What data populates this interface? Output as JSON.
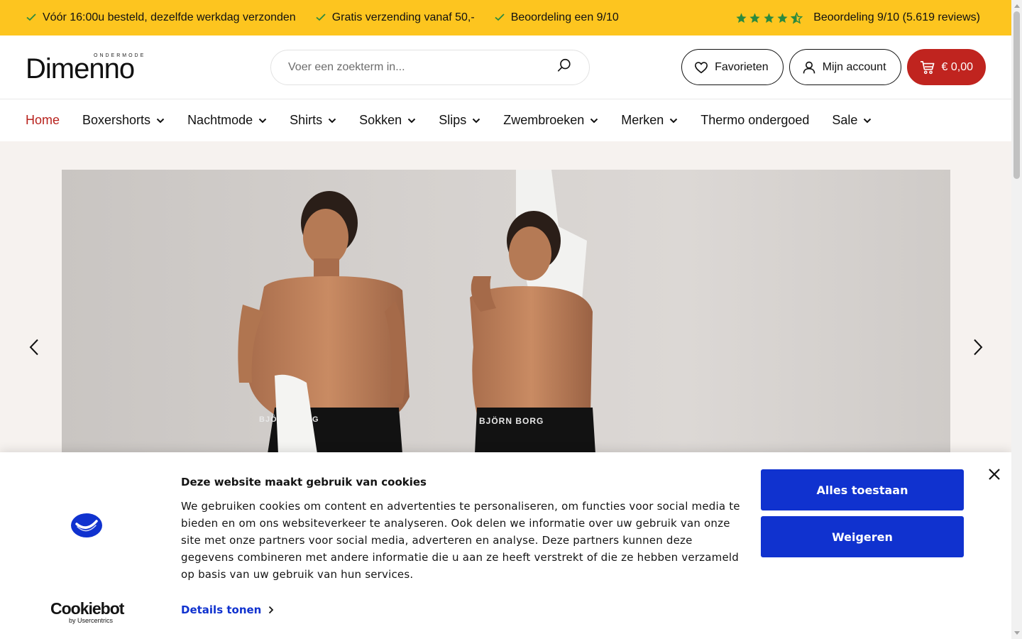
{
  "usp_bar": {
    "items": [
      {
        "icon": "check-icon",
        "text": "Vóór 16:00u besteld, dezelfde werkdag verzonden"
      },
      {
        "icon": "check-icon",
        "text": "Gratis verzending vanaf 50,-"
      },
      {
        "icon": "check-icon",
        "text": "Beoordeling een 9/10"
      }
    ],
    "rating_stars": 4.5,
    "rating_text": "Beoordeling 9/10 (5.619 reviews)",
    "background_color": "#fdc51f",
    "star_color": "#2c8a3e"
  },
  "header": {
    "logo_small": "ONDERMODE",
    "logo_main": "Dimenno",
    "search_placeholder": "Voer een zoekterm in...",
    "favorites_label": "Favorieten",
    "account_label": "Mijn account",
    "cart_total": "€ 0,00",
    "cart_color": "#c0241f"
  },
  "nav": {
    "items": [
      {
        "label": "Home",
        "active": true,
        "dropdown": false
      },
      {
        "label": "Boxershorts",
        "dropdown": true
      },
      {
        "label": "Nachtmode",
        "dropdown": true
      },
      {
        "label": "Shirts",
        "dropdown": true
      },
      {
        "label": "Sokken",
        "dropdown": true
      },
      {
        "label": "Slips",
        "dropdown": true
      },
      {
        "label": "Zwembroeken",
        "dropdown": true
      },
      {
        "label": "Merken",
        "dropdown": true
      },
      {
        "label": "Thermo ondergoed",
        "dropdown": false
      },
      {
        "label": "Sale",
        "dropdown": true
      }
    ],
    "active_color": "#b8231e"
  },
  "hero": {
    "waistband_text_left": "BJÖRN BORG",
    "waistband_text_right": "BJÖRN BORG"
  },
  "cookie_banner": {
    "title": "Deze website maakt gebruik van cookies",
    "body": "We gebruiken cookies om content en advertenties te personaliseren, om functies voor social media te bieden en om ons websiteverkeer te analyseren. Ook delen we informatie over uw gebruik van onze site met onze partners voor social media, adverteren en analyse. Deze partners kunnen deze gegevens combineren met andere informatie die u aan ze heeft verstrekt of die ze hebben verzameld op basis van uw gebruik van hun services.",
    "details_label": "Details tonen",
    "allow_label": "Alles toestaan",
    "deny_label": "Weigeren",
    "brand": "Cookiebot",
    "brand_sub": "by Usercentrics",
    "button_color": "#1032cf"
  }
}
